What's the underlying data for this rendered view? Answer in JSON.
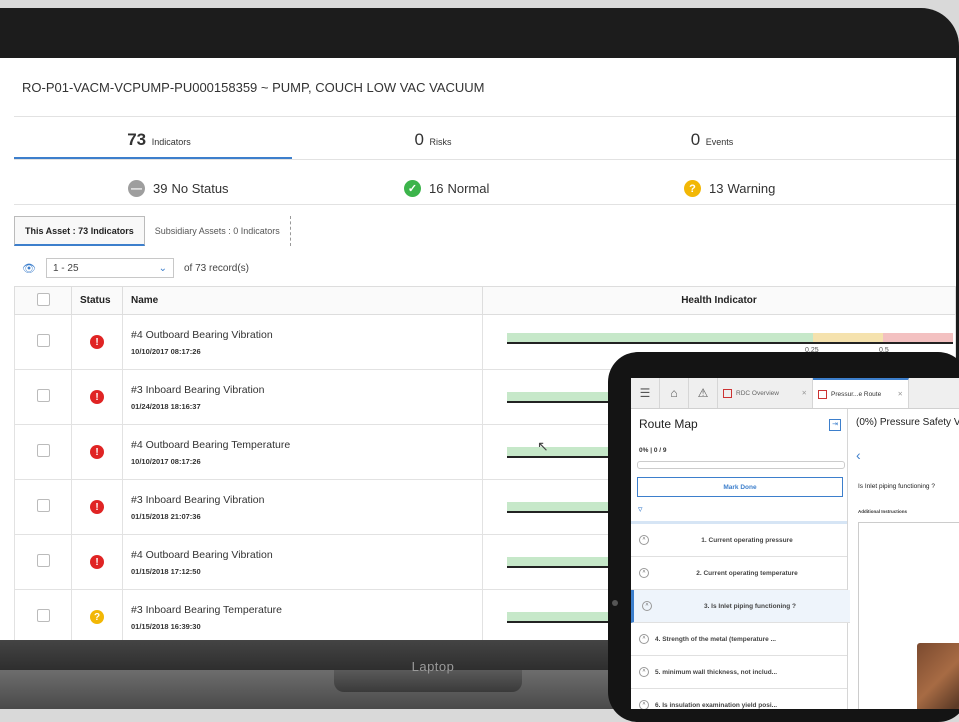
{
  "asset": {
    "title": "RO-P01-VACM-VCPUMP-PU000158359 ~ PUMP, COUCH LOW VAC VACUUM"
  },
  "kpis": [
    {
      "count": "73",
      "label": "Indicators"
    },
    {
      "count": "0",
      "label": "Risks"
    },
    {
      "count": "0",
      "label": "Events"
    }
  ],
  "status_summary": [
    {
      "count": "39",
      "label": "No Status",
      "color": "#9e9e9e"
    },
    {
      "count": "16",
      "label": "Normal",
      "color": "#3cb44b"
    },
    {
      "count": "13",
      "label": "Warning",
      "color": "#f2b705"
    }
  ],
  "tabs": [
    {
      "label": "This Asset : 73 Indicators"
    },
    {
      "label": "Subsidiary Assets : 0 Indicators"
    }
  ],
  "pager": {
    "range": "1 - 25",
    "total_text": "of 73 record(s)"
  },
  "table": {
    "columns": [
      "Status",
      "Name",
      "Health Indicator"
    ],
    "ticks": [
      "0.25",
      "0.5"
    ],
    "rows": [
      {
        "status": "alarm",
        "name": "#4 Outboard Bearing Vibration",
        "date": "10/10/2017 08:17:26"
      },
      {
        "status": "alarm",
        "name": "#3 Inboard Bearing Vibration",
        "date": "01/24/2018 18:16:37"
      },
      {
        "status": "alarm",
        "name": "#4 Outboard Bearing Temperature",
        "date": "10/10/2017 08:17:26"
      },
      {
        "status": "alarm",
        "name": "#3 Inboard Bearing Vibration",
        "date": "01/15/2018 21:07:36"
      },
      {
        "status": "alarm",
        "name": "#4 Outboard Bearing Vibration",
        "date": "01/15/2018 17:12:50"
      },
      {
        "status": "warning",
        "name": "#3 Inboard Bearing Temperature",
        "date": "01/15/2018 16:39:30"
      }
    ]
  },
  "device_label": "Laptop",
  "colors": {
    "accent": "#3d7fcc",
    "alarm": "#e02424",
    "warning": "#f2b705",
    "normal_band": "#c6e8c9"
  },
  "tablet": {
    "tabs": [
      {
        "label": "RDC Overview"
      },
      {
        "label": "Pressur...e Route"
      }
    ],
    "route_map": {
      "title": "Route Map",
      "progress_pct": "0%",
      "progress_count": "0 / 9",
      "progress_fraction": 0,
      "mark_done": "Mark Done",
      "items": [
        {
          "label": "1. Current operating pressure"
        },
        {
          "label": "2. Current operating temperature"
        },
        {
          "label": "3. Is Inlet piping functioning ?"
        },
        {
          "label": "4. Strength of the metal (temperature ..."
        },
        {
          "label": "5. minimum wall thickness, not includ..."
        },
        {
          "label": "6. Is insulation examination yield posi..."
        }
      ]
    },
    "detail": {
      "title": "(0%) Pressure Safety V",
      "question": "Is Inlet piping functioning ?",
      "additional": "Additional Instructions"
    }
  }
}
